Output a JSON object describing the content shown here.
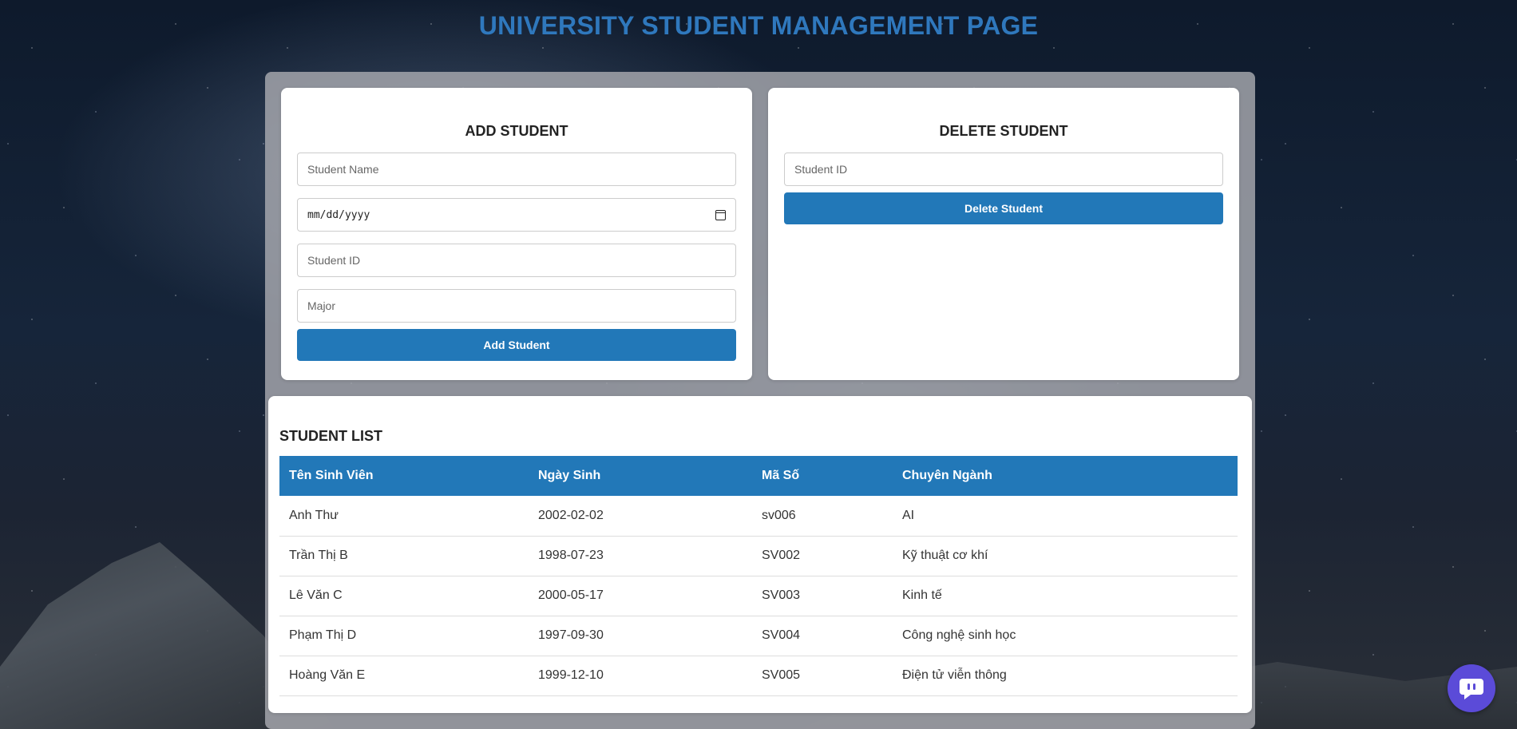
{
  "page": {
    "title": "UNIVERSITY STUDENT MANAGEMENT PAGE"
  },
  "add_student": {
    "heading": "ADD STUDENT",
    "name_placeholder": "Student Name",
    "date_placeholder": "mm/dd/yyyy",
    "id_placeholder": "Student ID",
    "major_placeholder": "Major",
    "button_label": "Add Student"
  },
  "delete_student": {
    "heading": "DELETE STUDENT",
    "id_placeholder": "Student ID",
    "button_label": "Delete Student"
  },
  "student_list": {
    "heading": "STUDENT LIST",
    "columns": [
      "Tên Sinh Viên",
      "Ngày Sinh",
      "Mã Số",
      "Chuyên Ngành"
    ],
    "rows": [
      [
        "Anh Thư",
        "2002-02-02",
        "sv006",
        "AI"
      ],
      [
        "Trần Thị B",
        "1998-07-23",
        "SV002",
        "Kỹ thuật cơ khí"
      ],
      [
        "Lê Văn C",
        "2000-05-17",
        "SV003",
        "Kinh tế"
      ],
      [
        "Phạm Thị D",
        "1997-09-30",
        "SV004",
        "Công nghệ sinh học"
      ],
      [
        "Hoàng Văn E",
        "1999-12-10",
        "SV005",
        "Điện tử viễn thông"
      ]
    ]
  },
  "colors": {
    "accent": "#2278b8",
    "title": "#2f78bd",
    "chat": "#5b4bd8"
  },
  "icons": {
    "date": "calendar-icon",
    "chat": "chat-icon"
  }
}
